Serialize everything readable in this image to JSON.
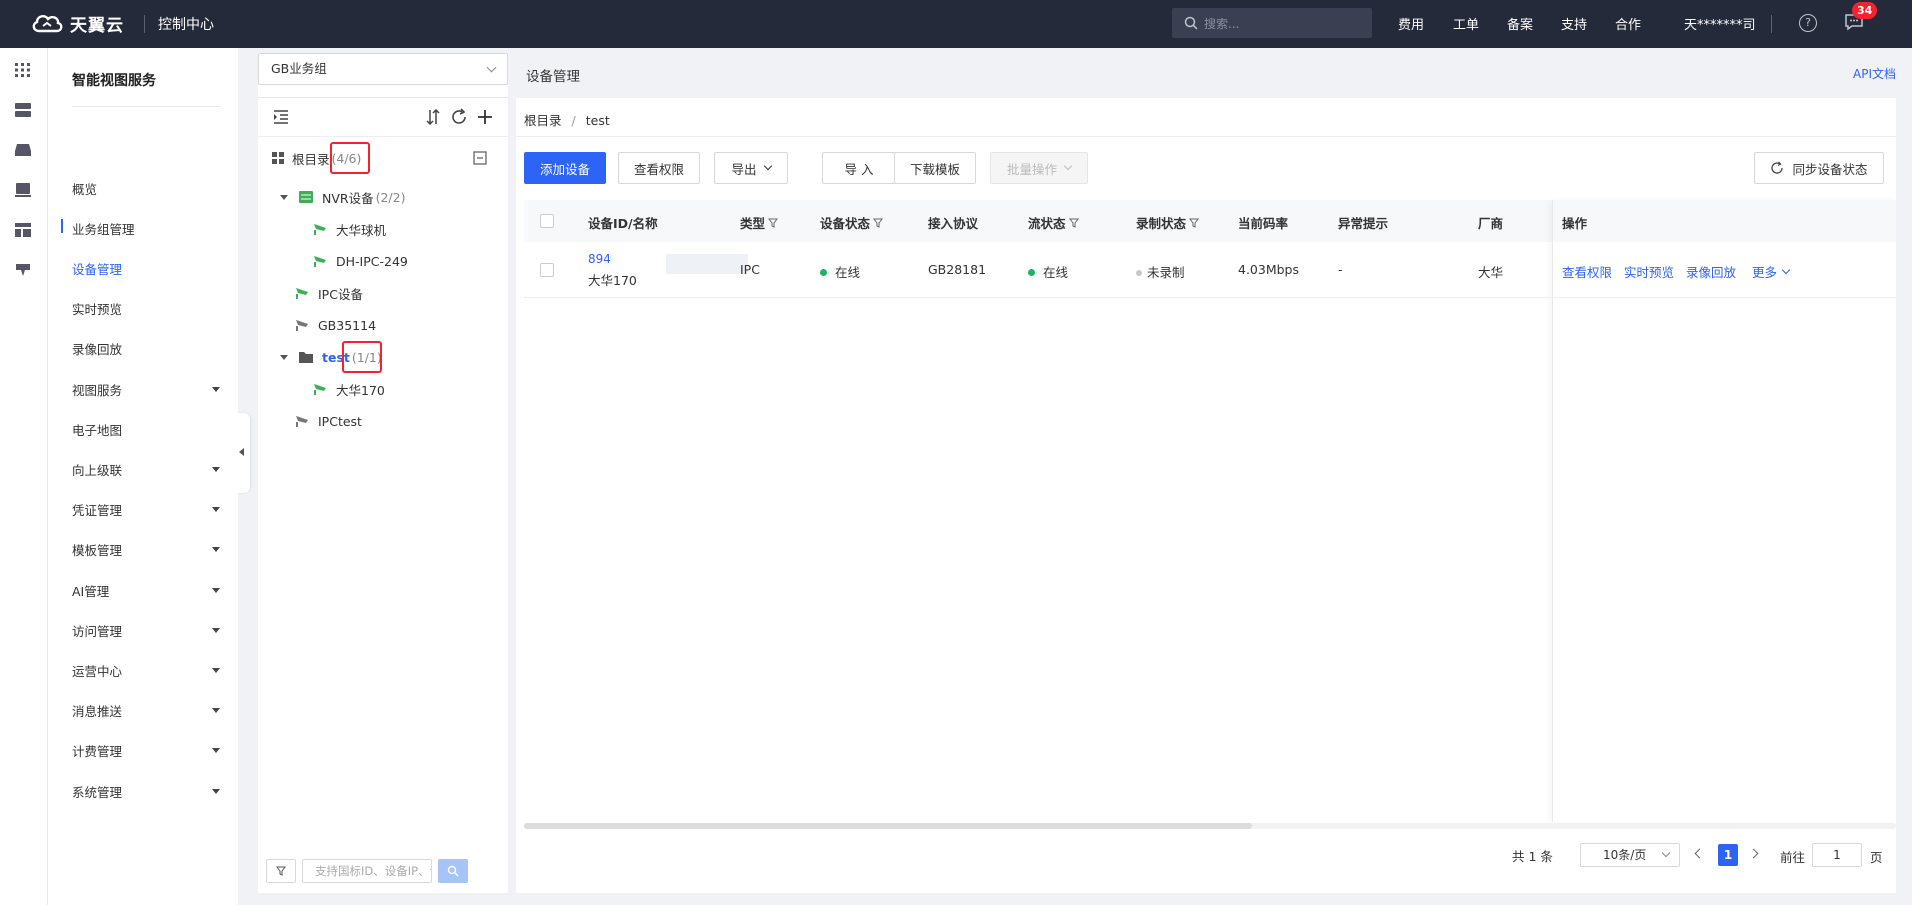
{
  "topbar": {
    "brand": "天翼云",
    "console": "控制中心",
    "search_placeholder": "搜索...",
    "nav": [
      "费用",
      "工单",
      "备案",
      "支持",
      "合作"
    ],
    "user": "天*******司",
    "notification_count": "34"
  },
  "sidebar": {
    "title": "智能视图服务",
    "items": [
      {
        "label": "概览",
        "expandable": false
      },
      {
        "label": "业务组管理",
        "expandable": false
      },
      {
        "label": "设备管理",
        "expandable": false,
        "active": true
      },
      {
        "label": "实时预览",
        "expandable": false
      },
      {
        "label": "录像回放",
        "expandable": false
      },
      {
        "label": "视图服务",
        "expandable": true
      },
      {
        "label": "电子地图",
        "expandable": false
      },
      {
        "label": "向上级联",
        "expandable": true
      },
      {
        "label": "凭证管理",
        "expandable": true
      },
      {
        "label": "模板管理",
        "expandable": true
      },
      {
        "label": "AI管理",
        "expandable": true
      },
      {
        "label": "访问管理",
        "expandable": true
      },
      {
        "label": "运营中心",
        "expandable": true
      },
      {
        "label": "消息推送",
        "expandable": true
      },
      {
        "label": "计费管理",
        "expandable": true
      },
      {
        "label": "系统管理",
        "expandable": true
      }
    ]
  },
  "tree": {
    "group_select": "GB业务组",
    "root": {
      "label": "根目录",
      "count": "(4/6)"
    },
    "nodes": {
      "nvr": {
        "label": "NVR设备",
        "count": "(2/2)"
      },
      "cam1": {
        "label": "大华球机"
      },
      "cam2": {
        "label": "DH-IPC-249"
      },
      "ipc": {
        "label": "IPC设备"
      },
      "gb": {
        "label": "GB35114"
      },
      "test": {
        "label": "test",
        "count": "(1/1)"
      },
      "dh170": {
        "label": "大华170"
      },
      "ipctest": {
        "label": "IPCtest"
      }
    },
    "search_placeholder": "支持国标ID、设备IP、设备名称"
  },
  "main": {
    "title": "设备管理",
    "api_doc": "API文档",
    "breadcrumb": [
      "根目录",
      "test"
    ],
    "breadcrumb_sep": "/",
    "buttons": {
      "add": "添加设备",
      "view_perm": "查看权限",
      "export": "导出",
      "import": "导 入",
      "download": "下载模板",
      "batch": "批量操作",
      "sync": "同步设备状态"
    },
    "columns": [
      "设备ID/名称",
      "类型",
      "设备状态",
      "接入协议",
      "流状态",
      "录制状态",
      "当前码率",
      "异常提示",
      "厂商",
      "操作"
    ],
    "rows": [
      {
        "id": "894",
        "name": "大华170",
        "type": "IPC",
        "device_status": "在线",
        "protocol": "GB28181",
        "stream_status": "在线",
        "record_status": "未录制",
        "bitrate": "4.03Mbps",
        "alert": "-",
        "vendor": "大华",
        "ops": [
          "查看权限",
          "实时预览",
          "录像回放",
          "更多"
        ]
      }
    ],
    "status_colors": {
      "online": "#22b35e",
      "not_recording": "#c8c8c8"
    },
    "pagination": {
      "total": "共 1 条",
      "page_size": "10条/页",
      "current": "1",
      "goto_label": "前往",
      "goto_value": "1",
      "page_unit": "页"
    }
  },
  "colors": {
    "accent": "#2d64f5",
    "topbar": "#252a3a",
    "highlight": "#f5222d"
  }
}
